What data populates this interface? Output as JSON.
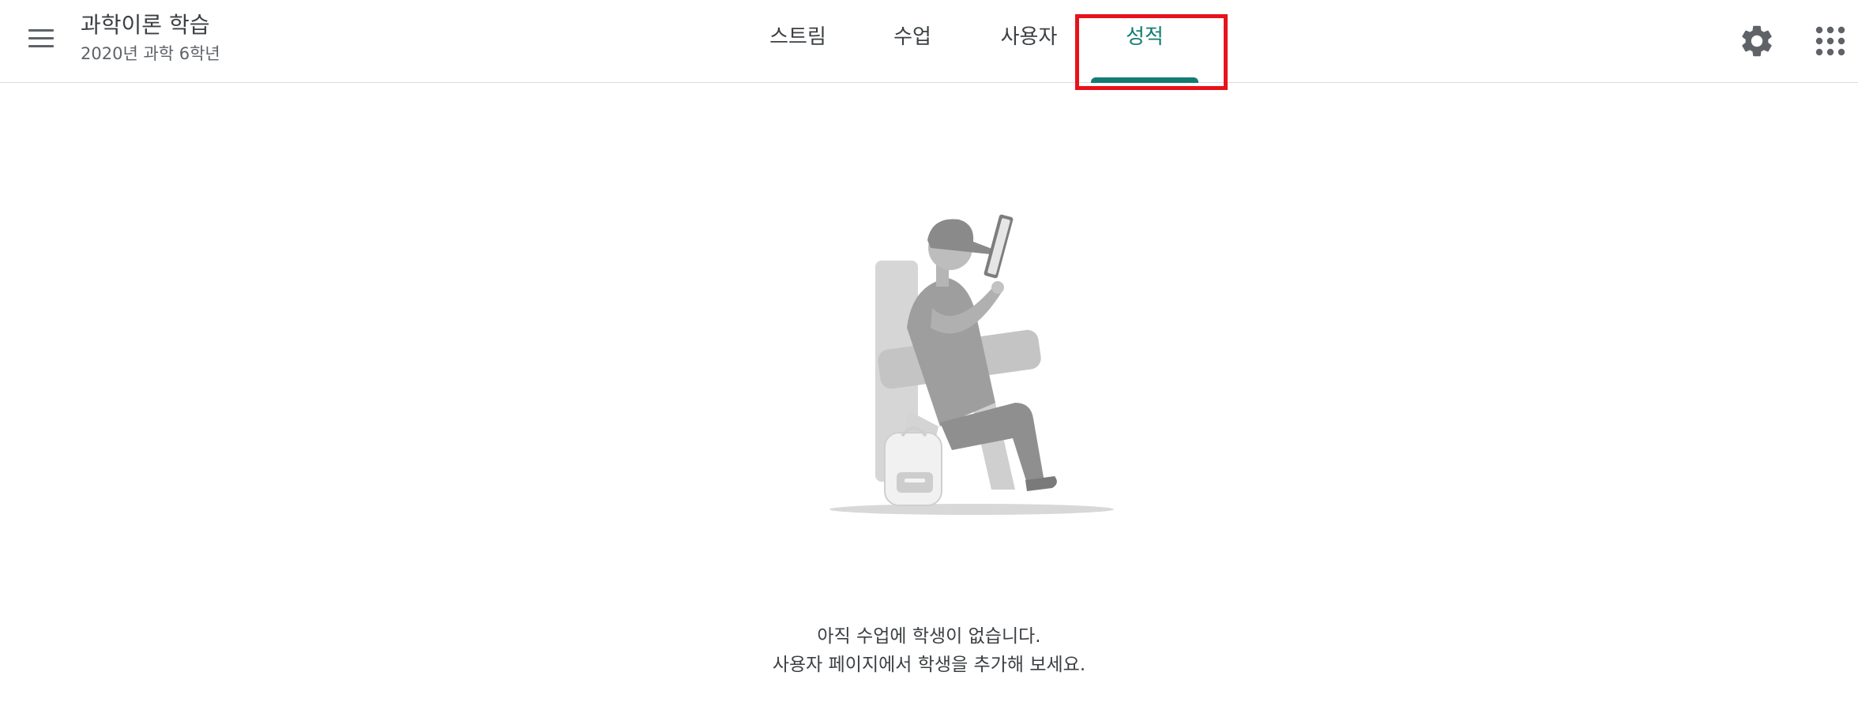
{
  "header": {
    "class_title": "과학이론 학습",
    "class_subtitle": "2020년 과학 6학년",
    "tabs": [
      {
        "label": "스트림"
      },
      {
        "label": "수업"
      },
      {
        "label": "사용자"
      },
      {
        "label": "성적",
        "active": true
      }
    ],
    "icons": {
      "menu": "hamburger-menu-icon",
      "settings": "gear-icon",
      "apps": "apps-grid-icon"
    }
  },
  "empty_state": {
    "line1": "아직 수업에 학생이 없습니다.",
    "line2": "사용자 페이지에서 학생을 추가해 보세요."
  },
  "colors": {
    "accent": "#137c73",
    "highlight": "#e8121b",
    "text": "#3c4043",
    "divider": "#dadce0"
  }
}
